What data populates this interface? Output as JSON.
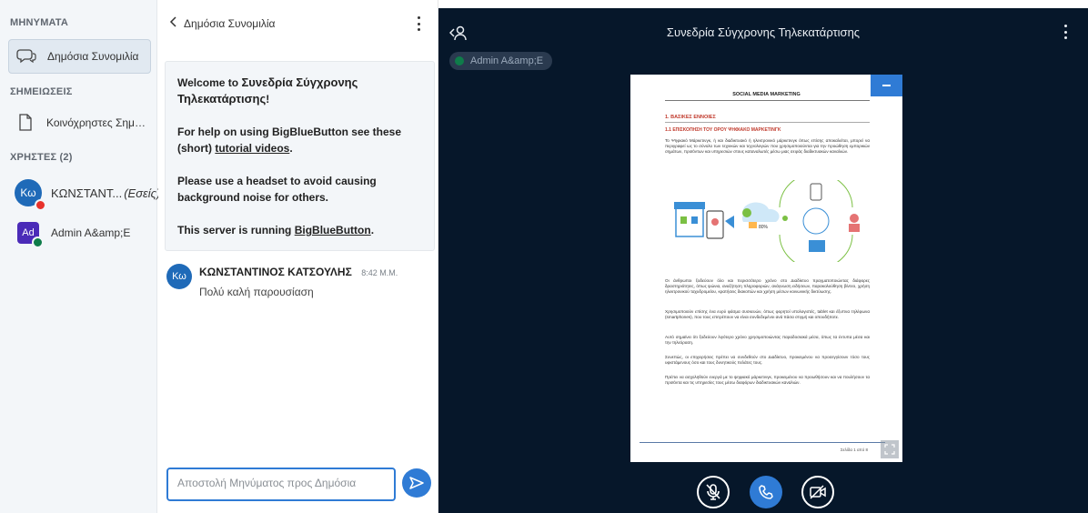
{
  "userlist": {
    "messages_title": "ΜΗΝΥΜΑΤΑ",
    "public_chat_label": "Δημόσια Συνομιλία",
    "notes_title": "ΣΗΜΕΙΩΣΕΙΣ",
    "shared_notes_label": "Κοινόχρηστες Σημει...",
    "users_title": "ΧΡΗΣΤΕΣ (2)",
    "users": [
      {
        "initials": "Κω",
        "name": "ΚΩΝΣΤΑΝΤ...",
        "suffix": "(Εσείς)",
        "color": "#1f6ab8",
        "badge_color": "#e8322b"
      },
      {
        "initials": "Ad",
        "name": "Admin A&amp;E",
        "suffix": "",
        "color": "#4b2bb8",
        "badge_color": "#0f7c4a"
      }
    ]
  },
  "chat": {
    "title": "Δημόσια Συνομιλία",
    "welcome": {
      "line1_prefix": "Welcome to ",
      "line1_brand": "Συνεδρία Σύγχρονης Τηλεκατάρτισης",
      "line1_suffix": "!",
      "line2_prefix": "For help on using BigBlueButton see these (short) ",
      "line2_link": "tutorial videos",
      "line2_suffix": ".",
      "line3": "Please use a headset to avoid causing background noise for others.",
      "line4_prefix": "This server is running ",
      "line4_link": "BigBlueButton",
      "line4_suffix": "."
    },
    "message": {
      "initials": "Κω",
      "author": "ΚΩΝΣΤΑΝΤΙΝΟΣ ΚΑΤΣΟΥΛΗΣ",
      "time": "8:42 Μ.Μ.",
      "text": "Πολύ καλή παρουσίαση"
    },
    "input_placeholder": "Αποστολή Μηνύματος προς Δημόσια"
  },
  "meeting": {
    "title": "Συνεδρία Σύγχρονης Τηλεκατάρτισης",
    "talker": "Admin A&amp;E"
  },
  "slide": {
    "header": "SOCIAL MEDIA MARKETING",
    "h1": "1. ΒΑΣΙΚΕΣ ΕΝΝΟΙΕΣ",
    "h2": "1.1 ΕΠΙΣΚΟΠΗΣΗ ΤΟΥ ΟΡΟΥ ΨΗΦΙΑΚΟ ΜΑΡΚΕΤΙΝΓΚ",
    "p1": "Το Ψηφιακό Μάρκετινγκ, ή και διαδικτυακό ή ηλεκτρονικό μάρκετινγκ όπως επίσης αποκαλείται, μπορεί να περιγραφεί ως το σύνολο των τεχνικών και τεχνολογιών που χρησιμοποιούνται για την προώθηση εμπορικών σημάτων, προϊόντων και υπηρεσιών στους καταναλωτές μέσω μιας σειράς διαδικτυακών καναλιών.",
    "p2": "Οι άνθρωποι ξοδεύουν όλο και περισσότερο χρόνο στο Διαδίκτυο πραγματοποιώντας διάφορες δραστηριότητες, όπως ψώνια, αναζήτηση πληροφοριών, ανάγνωση ειδήσεων, παρακολούθηση βίντεο, χρήση ηλεκτρονικού ταχυδρομείου, κρατήσεις διακοπών και χρήση μέσων κοινωνικής δικτύωσης.",
    "p3": "Χρησιμοποιούν επίσης ένα ευρύ φάσμα συσκευών, όπως φορητοί υπολογιστές, tablet και έξυπνα τηλέφωνα (smartphones), που τους επιτρέπουν να είναι συνδεδεμένοι ανά πάσα στιγμή και οπουδήποτε.",
    "p4": "Αυτό σημαίνει ότι ξοδεύουν λιγότερο χρόνο χρησιμοποιώντας παραδοσιακά μέσα, όπως τα έντυπα μέσα και την τηλεόραση.",
    "p5": "Συνεπώς, οι επιχειρήσεις πρέπει να συνδεθούν στο Διαδίκτυο, προκειμένου να προσεγγίσουν τόσο τους υφιστάμενους όσο και τους δυνητικούς πελάτες τους.",
    "p6": "Πρέπει να ασχοληθούν ενεργά με το ψηφιακό μάρκετινγκ, προκειμένου να προωθήσουν και να πουλήσουν τα προϊόντα και τις υπηρεσίες τους μέσω διαφόρων διαδικτυακών καναλιών.",
    "page": "Σελίδα 1 από 8",
    "illus_percent": "80%"
  },
  "colors": {
    "accent": "#2f7bd5",
    "meeting_bg": "#06172a",
    "slide_heading": "#c0392b"
  },
  "icons": {
    "public_chat": "chat-bubble-icon",
    "notes": "document-icon",
    "back": "chevron-left-icon",
    "send": "send-arrow-icon",
    "mic_muted": "microphone-off-icon",
    "phone": "phone-icon",
    "camera_off": "camera-off-icon"
  }
}
